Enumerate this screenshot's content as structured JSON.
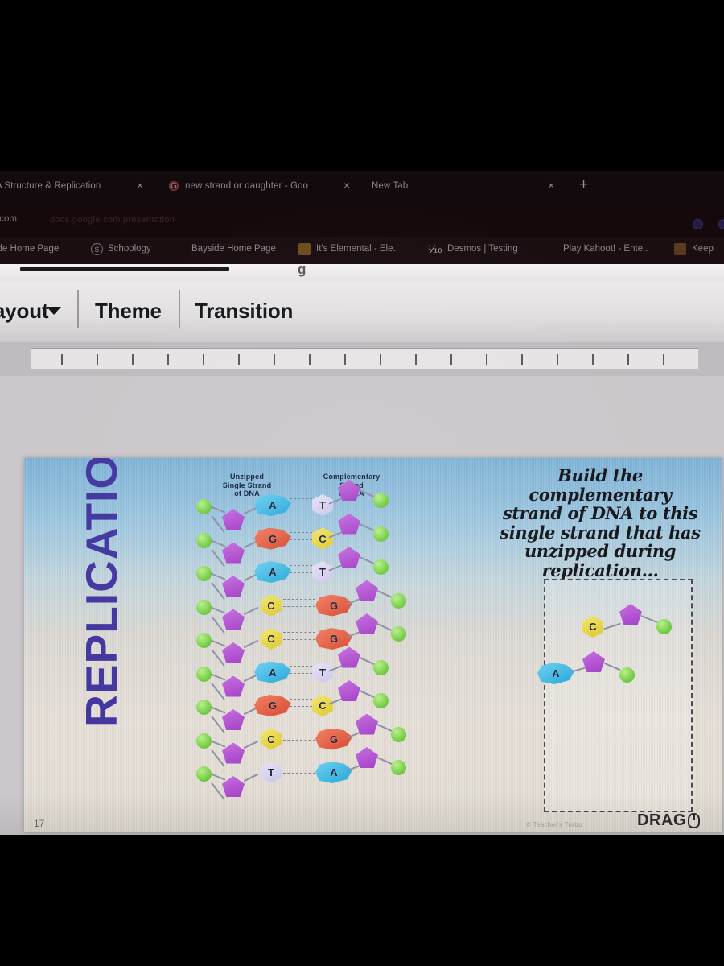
{
  "browser": {
    "tabs": [
      {
        "label": "A Structure & Replication",
        "favicon": "none",
        "close": "×"
      },
      {
        "label": "new strand or daughter - Goo",
        "favicon": "google-icon",
        "close": "×"
      },
      {
        "label": "New Tab",
        "favicon": "none",
        "close": "×"
      }
    ],
    "new_tab_button": "+",
    "address_bar": {
      "value": ".com",
      "ghost_text": "docs.google.com presentation"
    },
    "bookmarks": [
      {
        "label": "ide Home Page",
        "icon": "none"
      },
      {
        "label": "Schoology",
        "icon": "schoology-icon"
      },
      {
        "label": "Bayside Home Page",
        "icon": "none"
      },
      {
        "label": "It's Elemental - Ele..",
        "icon": "elemental-icon"
      },
      {
        "label": "Desmos | Testing",
        "icon": "desmos-icon"
      },
      {
        "label": "Play Kahoot! - Ente..",
        "icon": "none"
      },
      {
        "label": "Keep",
        "icon": "keep-icon"
      }
    ]
  },
  "slides_toolbar": {
    "layout_label": "ayout",
    "layout_caret": "▼",
    "theme_label": "Theme",
    "transition_label": "Transition"
  },
  "slide": {
    "title": "REPLICATION",
    "number": "17",
    "credit": "© Teacher's Turbo",
    "drag_label": "DRAG",
    "drag_icon": "mouse-icon",
    "headings": {
      "left": "Unzipped\nSingle Strand\nof DNA",
      "left_lines": [
        "Unzipped",
        "Single Strand",
        "of DNA"
      ],
      "right_lines": [
        "Complementary",
        "Strand",
        "of DNA"
      ]
    },
    "instruction_lines": [
      "Build the complementary",
      "strand of DNA to this",
      "single strand that has",
      "unzipped during replication..."
    ],
    "colors": {
      "title": "#4438a0",
      "phosphate": "#6dc93f",
      "sugar": "#a33fc6",
      "adenine": "#23a7da",
      "guanine": "#d9482f",
      "thymine": "#c9c3e8",
      "cytosine": "#ddc62a",
      "background_top": "#7fb4d8",
      "background_bottom": "#e3ddd4"
    },
    "base_pairs": [
      {
        "left": "A",
        "right": "T"
      },
      {
        "left": "G",
        "right": "C"
      },
      {
        "left": "A",
        "right": "T"
      },
      {
        "left": "C",
        "right": "G"
      },
      {
        "left": "C",
        "right": "G"
      },
      {
        "left": "A",
        "right": "T"
      },
      {
        "left": "G",
        "right": "C"
      },
      {
        "left": "C",
        "right": "G"
      },
      {
        "left": "T",
        "right": "A"
      }
    ],
    "dropzone_pieces": [
      {
        "base": "C"
      },
      {
        "base": "A"
      }
    ]
  },
  "taskbar": {
    "icons": [
      {
        "name": "zoom-app-icon"
      },
      {
        "name": "google-slides-icon"
      },
      {
        "name": "chrome-icon"
      },
      {
        "name": "google-drive-icon"
      },
      {
        "name": "photos-app-icon"
      }
    ]
  }
}
